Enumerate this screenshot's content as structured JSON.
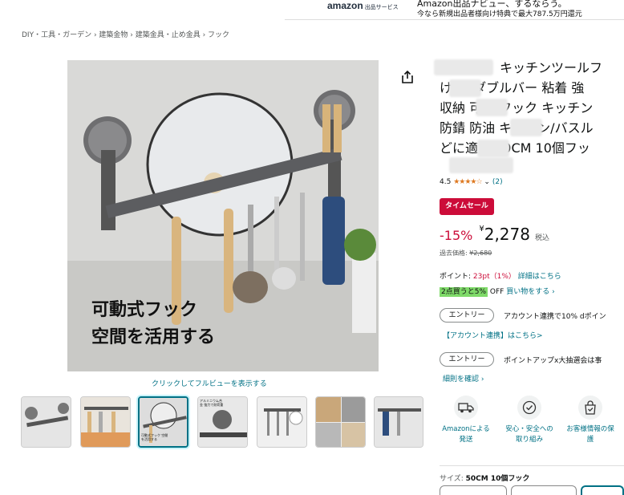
{
  "banner": {
    "logo": "amazon",
    "logo_sub": "出品サービス",
    "line1": "Amazon出品ナビュー、するならう。",
    "line2": "今なら新規出品者様向け特典で最大787.5万円還元"
  },
  "breadcrumb": "DIY・工具・ガーデン › 建築金物 › 建築金具・止め金具 › フック",
  "image": {
    "overlay_line1": "可動式フック",
    "overlay_line2": "空間を活用する",
    "zoom_link": "クリックしてフルビューを表示する"
  },
  "thumbnails": [
    {
      "label": ""
    },
    {
      "label": ""
    },
    {
      "label": "可動式フック 空間を活用する"
    },
    {
      "label": "アルミニウム合金 強力で耐荷重"
    },
    {
      "label": ""
    },
    {
      "label": ""
    },
    {
      "label": ""
    }
  ],
  "product": {
    "title_line1": "キッチンツールフ",
    "title_line2": "け 面 ダブルバー 粘着 強",
    "title_line3": "収納 可動 フック キッチン",
    "title_line4": "防錆 防油 キッチン/バスル",
    "title_line5": "どに適用 50CM 10個フッ",
    "rating_value": "4.5",
    "stars": "★★★★☆",
    "rating_count": "(2)",
    "sale_badge": "タイムセール",
    "discount": "-15%",
    "currency": "¥",
    "price": "2,278",
    "tax_note": "税込",
    "list_price_label": "過去価格:",
    "list_price": "¥2,680",
    "points_label": "ポイント:",
    "points_value": "23pt（1%）",
    "points_link": "詳細はこちら",
    "bulk_tag": "2点買うと5%",
    "bulk_off": "OFF",
    "bulk_link": "買い物をする ›"
  },
  "promos": [
    {
      "pill": "エントリー",
      "text": "アカウント連携で10% dポイン",
      "link": "【アカウント連携】はこちら>"
    },
    {
      "pill": "エントリー",
      "text": "ポイントアップx大抽選会は事",
      "link": "細則を確認 ›"
    }
  ],
  "features": [
    {
      "icon": "truck-icon",
      "label": "Amazonによる発送"
    },
    {
      "icon": "shield-check-icon",
      "label": "安心・安全への取り組み"
    },
    {
      "icon": "secure-bag-icon",
      "label": "お客様情報の保護"
    }
  ],
  "size": {
    "label": "サイズ:",
    "value": "50CM 10個フック"
  },
  "colors": {
    "link": "#007185",
    "sale": "#cc0c39",
    "star": "#de7921",
    "bulk": "#7fda69"
  }
}
